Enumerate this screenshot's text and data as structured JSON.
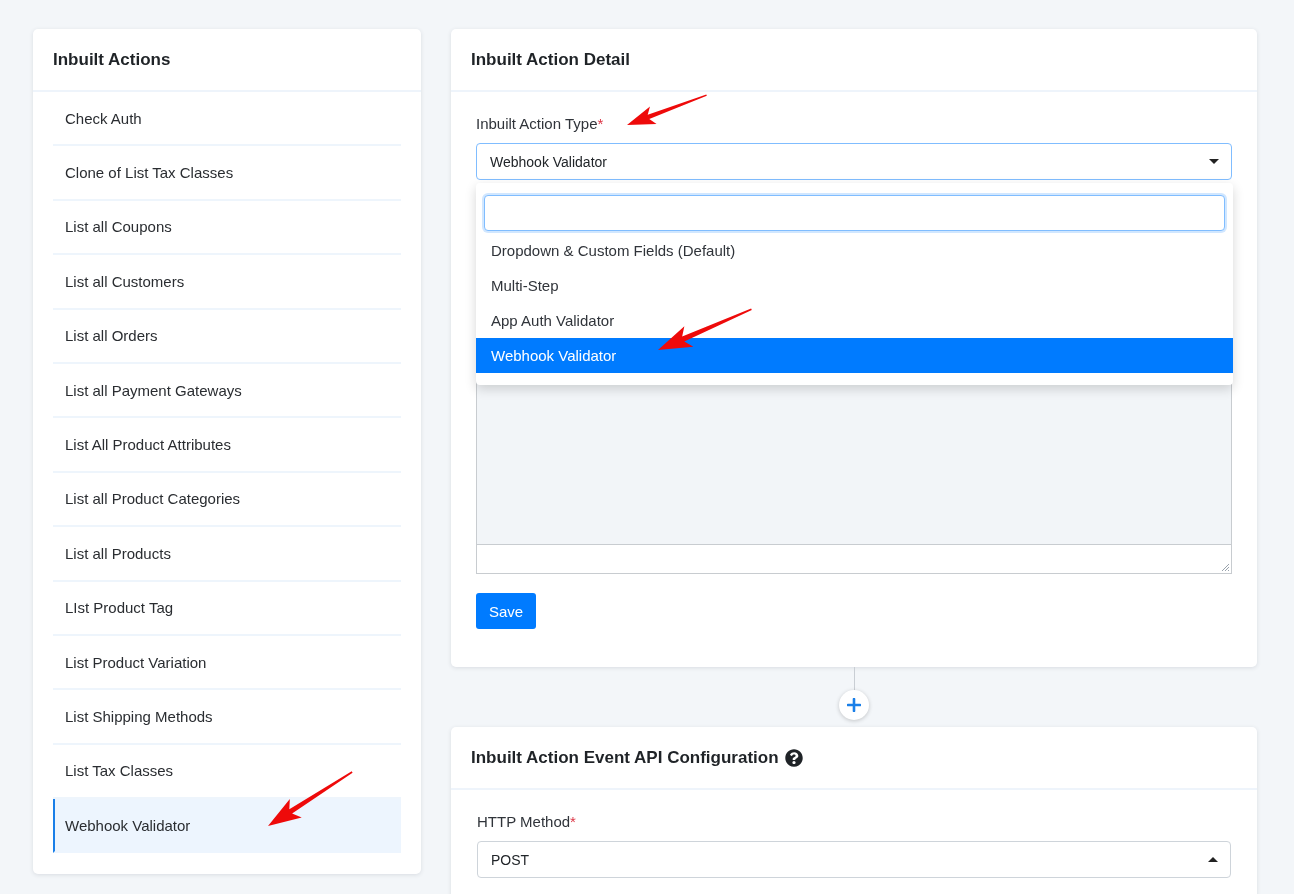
{
  "sidebar": {
    "title": "Inbuilt Actions",
    "items": [
      {
        "label": "Check Auth",
        "selected": false
      },
      {
        "label": "Clone of List Tax Classes",
        "selected": false
      },
      {
        "label": "List all Coupons",
        "selected": false
      },
      {
        "label": "List all Customers",
        "selected": false
      },
      {
        "label": "List all Orders",
        "selected": false
      },
      {
        "label": "List all Payment Gateways",
        "selected": false
      },
      {
        "label": "List All Product Attributes",
        "selected": false
      },
      {
        "label": "List all Product Categories",
        "selected": false
      },
      {
        "label": "List all Products",
        "selected": false
      },
      {
        "label": "LIst Product Tag",
        "selected": false
      },
      {
        "label": "List Product Variation",
        "selected": false
      },
      {
        "label": "List Shipping Methods",
        "selected": false
      },
      {
        "label": "List Tax Classes",
        "selected": false
      },
      {
        "label": "Webhook Validator",
        "selected": true
      }
    ]
  },
  "detail_panel": {
    "title": "Inbuilt Action Detail",
    "type_field": {
      "label": "Inbuilt Action Type",
      "required_mark": "*",
      "value": "Webhook Validator",
      "expanded": true,
      "options": [
        {
          "label": "Dropdown & Custom Fields (Default)",
          "selected": false
        },
        {
          "label": "Multi-Step",
          "selected": false
        },
        {
          "label": "App Auth Validator",
          "selected": false
        },
        {
          "label": "Webhook Validator",
          "selected": true
        }
      ]
    },
    "save_button": "Save"
  },
  "config_panel": {
    "title": "Inbuilt Action Event API Configuration",
    "method_field": {
      "label": "HTTP Method",
      "required_mark": "*",
      "value": "POST",
      "expanded": false
    }
  }
}
